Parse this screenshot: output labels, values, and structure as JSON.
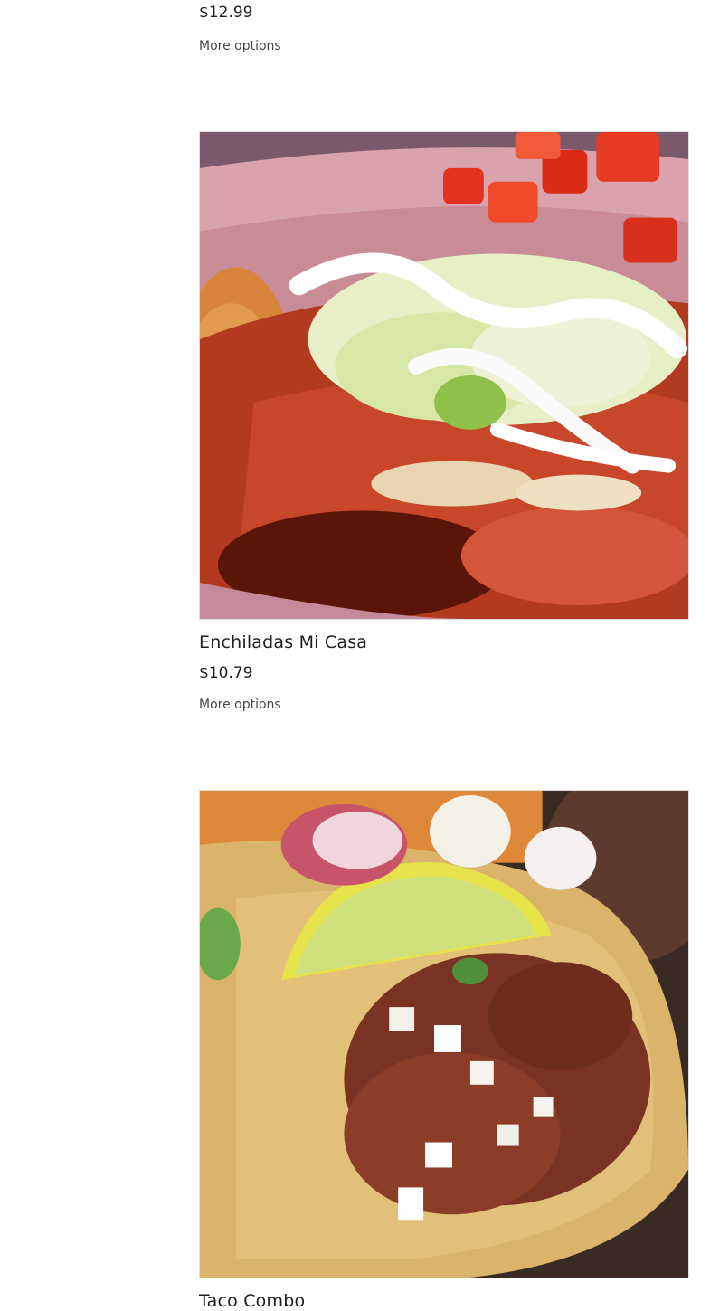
{
  "menu_items": [
    {
      "name": "",
      "price": "$12.99",
      "more_options": "More options"
    },
    {
      "name": "Enchiladas Mi Casa",
      "price": "$10.79",
      "more_options": "More options",
      "image_subject": "enchiladas-photo"
    },
    {
      "name": "Taco Combo",
      "price": "",
      "more_options": "",
      "image_subject": "tacos-photo"
    }
  ]
}
